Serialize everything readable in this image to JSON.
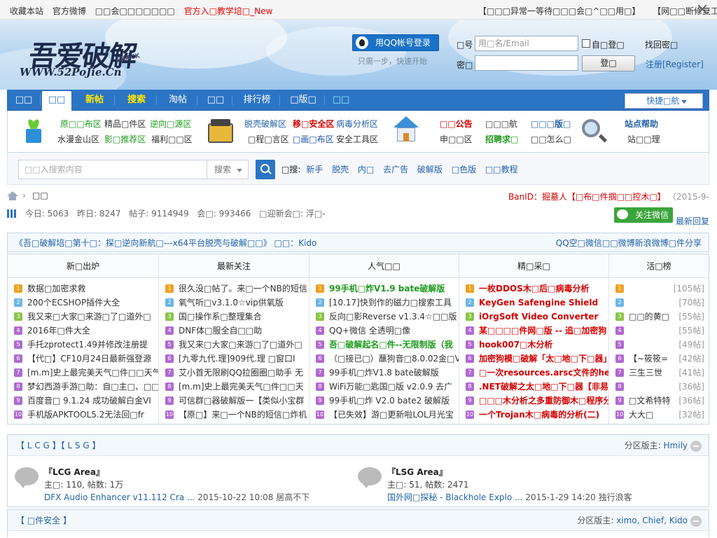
{
  "topbar": {
    "left": [
      "收藏本站",
      "官方微博",
      "官方入口",
      "官方入口教学培训_New"
    ],
    "left_display": [
      "收藏本站",
      "官方微博",
      "□□会□□□□□□□"
    ],
    "promo": "官方入□教学培□_New",
    "right": [
      "【□□□异常一等待□□□会□^□□用□】",
      "【网□□断修复工具】"
    ]
  },
  "header": {
    "logo_cn": "吾爱破解",
    "logo_en": "WWW.52PoJie.Cn",
    "logo_tag": "CRACK",
    "qq_login": "用QQ帐号登录",
    "qq_hint": "只需一步，快速开始",
    "user_label": "□号",
    "user_placeholder": "用□名/Email",
    "remember": "自□登□",
    "pass_label": "密□",
    "login": "登□",
    "forgot": "找回密□",
    "register": "注册[Register]"
  },
  "nav": {
    "items": [
      "□□",
      "□□",
      "新帖",
      "搜索",
      "淘帖",
      "□□",
      "排行榜",
      "□版□",
      "□□"
    ],
    "quick": "快捷□航"
  },
  "subnav": {
    "g1a": [
      "原□□布区",
      "精品□件区",
      "逆向□源区"
    ],
    "g1b": [
      "水漫金山区",
      "影□推荐区",
      "福利□□区"
    ],
    "g2a": [
      "脱壳破解区",
      "移□安全区",
      "病毒分析区"
    ],
    "g2b": [
      "□程□言区",
      "□画□布区",
      "安全工具区"
    ],
    "g3a": [
      "□□公告",
      "□□□航",
      "□□□版□"
    ],
    "g3b": [
      "申□□区",
      "招聘求□",
      "□□怎么□"
    ],
    "g4a": "站点帮助",
    "g4b": "站□□理"
  },
  "search": {
    "placeholder": "□□入搜索内容",
    "type": "搜索",
    "hot_label": "□搜:",
    "hot": [
      "新手",
      "脱壳",
      "内□",
      "去广告",
      "破解版",
      "□色版",
      "□□教程"
    ]
  },
  "crumb": {
    "label": "□□",
    "banid": "BanID：掘墓人【□布□件掴□□控木□】",
    "date": "（2015-9-"
  },
  "stats": {
    "today": "今日: 5063",
    "yesterday": "昨日: 8247",
    "posts": "帖子: 9114949",
    "members": "会□: 993466",
    "newest": "□迎新会□: 浮□-",
    "wechat": "关注微信",
    "latest": "最新回复"
  },
  "notice": {
    "left": "《吾□破解培□第十□：探□逆向新航□---x64平台脱壳与破解□□》 □□：Kido",
    "right": "QQ空□微信□□微博新浪微博□件分享"
  },
  "columns": [
    {
      "title": "新□出炉",
      "items": [
        "数据□加密求救",
        "200个ECSHOP插件大全",
        "我又来□大家□来游□了□道外□",
        "2016年□件大全",
        "手托zprotect1.49并修改注册提",
        "【代□】CF10月24日最新强登源",
        "[m.m]史上最完美天气□件□□天气",
        "梦幻西游手游□助：自□主□、□□",
        "百度音□ 9.1.24 成功破解白金VI",
        "手机版APKTOOL5.2无法回□fr"
      ]
    },
    {
      "title": "最新关注",
      "items": [
        "很久没□帖了。来□一个NB的短信",
        "氧气听□v3.1.0☆vip供氧版",
        "国□操作系□整理集合",
        "DNF体□服全自□□助",
        "我又来□大家□来游□了□道外□",
        "[九零九代.理]909代.理 □窗口I",
        "艾小首无限刷QQ拉圈圈□助手 无",
        "[m.m]史上最完美天气□件□□天",
        "可信群□器破解版一【类似小宝群",
        "【原□】来□一个NB的短信□炸机"
      ]
    },
    {
      "title": "人气□□",
      "items": [
        "99手机□炸V1.9 bate破解版",
        "[10.17]快到作的磁力□搜索工具",
        "反向□影Reverse v1.3.4☆□□版",
        "QQ+微信 全透明□像",
        "吾□破解起名□件--无限制版（我",
        "（□接已□）蘸狗音□8.0.02金□V",
        "99手机□炸V1.8 bate破解版",
        "WiFi万能□匙国□版 v2.0.9 去广",
        "99手机□炸 V2.0 bate2 破解版",
        "【已失效】游□更新啦LOL月光宝"
      ]
    },
    {
      "title": "精□采□",
      "items": [
        "一枚DDOS木□后□病毒分析",
        "KeyGen Safengine Shield",
        "iOrgSoft Video Converter",
        "某□□□□件网□版 -- 追□加密狗",
        "hook007□木分析",
        "加密狗模□破解「太□地□下□器」",
        "□一次resources.arsc文件的he",
        ".NET破解之太□地□下□器【非易",
        "□□□木分析之多重防御木□程序分",
        "一个Trojan木□病毒的分析(二)"
      ]
    },
    {
      "title": "活□榜",
      "items": [
        "",
        "",
        "□□的黄□",
        "",
        "",
        "【~筱筱=",
        "三生三世",
        "",
        "□文希特特",
        "大大□"
      ],
      "counts": [
        "[105帖]",
        "[70帖]",
        "[55帖]",
        "[55帖]",
        "[49帖]",
        "[42帖]",
        "[41帖]",
        "[36帖]",
        "[36帖]",
        "[32帖]"
      ]
    }
  ],
  "section1": {
    "title": "【 L C G 】【 L S G 】",
    "mods_label": "分区版主:",
    "mods": "Hmily",
    "forums": [
      {
        "name": "『LCG Area』",
        "stat": "主□: 110, 帖数: 1万",
        "last_link": "DFX Audio Enhancer v11.112 Cra ...",
        "last_meta": "2015-10-22 10:08 居高不下"
      },
      {
        "name": "『LSG Area』",
        "stat": "主□: 51, 帖数: 2471",
        "last_link": "国外网□探秘 - Blackhole Explo ...",
        "last_meta": "2015-1-29 14:20 独行浪客"
      }
    ]
  },
  "section2": {
    "title": "【 □件安全 】",
    "mods_label": "分区版主:",
    "mods": "ximo, Chief, Kido"
  },
  "colors": {
    "nav": "#2c74c4",
    "red": "#dd0000",
    "green": "#1e9b1e",
    "link": "#2563a8"
  }
}
